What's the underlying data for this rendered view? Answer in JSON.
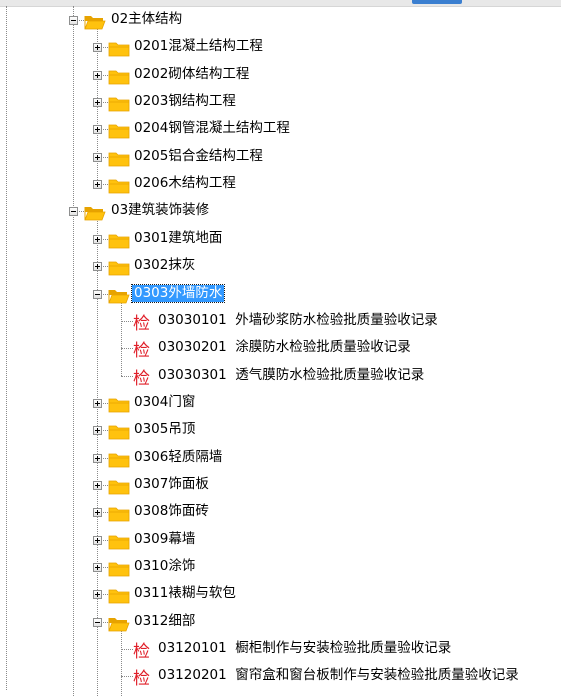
{
  "colors": {
    "folder_fill": "#ffc20e",
    "folder_dark": "#e7a300",
    "selected_bg": "#3399ff",
    "check_icon": "#e0202a"
  },
  "tree": {
    "nodes": [
      {
        "id": "n02",
        "label": "02主体结构",
        "level": 1,
        "kind": "folder",
        "state": "open"
      },
      {
        "id": "n0201",
        "label": "0201混凝土结构工程",
        "level": 2,
        "kind": "folder",
        "state": "closed"
      },
      {
        "id": "n0202",
        "label": "0202砌体结构工程",
        "level": 2,
        "kind": "folder",
        "state": "closed"
      },
      {
        "id": "n0203",
        "label": "0203钢结构工程",
        "level": 2,
        "kind": "folder",
        "state": "closed"
      },
      {
        "id": "n0204",
        "label": "0204钢管混凝土结构工程",
        "level": 2,
        "kind": "folder",
        "state": "closed"
      },
      {
        "id": "n0205",
        "label": "0205铝合金结构工程",
        "level": 2,
        "kind": "folder",
        "state": "closed"
      },
      {
        "id": "n0206",
        "label": "0206木结构工程",
        "level": 2,
        "kind": "folder",
        "state": "closed"
      },
      {
        "id": "n03",
        "label": "03建筑装饰装修",
        "level": 1,
        "kind": "folder",
        "state": "open"
      },
      {
        "id": "n0301",
        "label": "0301建筑地面",
        "level": 2,
        "kind": "folder",
        "state": "closed"
      },
      {
        "id": "n0302",
        "label": "0302抹灰",
        "level": 2,
        "kind": "folder",
        "state": "closed"
      },
      {
        "id": "n0303",
        "label": "0303外墙防水",
        "level": 2,
        "kind": "folder",
        "state": "open",
        "selected": true
      },
      {
        "id": "n03030101",
        "label": "03030101  外墙砂浆防水检验批质量验收记录",
        "level": 3,
        "kind": "record"
      },
      {
        "id": "n03030201",
        "label": "03030201  涂膜防水检验批质量验收记录",
        "level": 3,
        "kind": "record"
      },
      {
        "id": "n03030301",
        "label": "03030301  透气膜防水检验批质量验收记录",
        "level": 3,
        "kind": "record"
      },
      {
        "id": "n0304",
        "label": "0304门窗",
        "level": 2,
        "kind": "folder",
        "state": "closed"
      },
      {
        "id": "n0305",
        "label": "0305吊顶",
        "level": 2,
        "kind": "folder",
        "state": "closed"
      },
      {
        "id": "n0306",
        "label": "0306轻质隔墙",
        "level": 2,
        "kind": "folder",
        "state": "closed"
      },
      {
        "id": "n0307",
        "label": "0307饰面板",
        "level": 2,
        "kind": "folder",
        "state": "closed"
      },
      {
        "id": "n0308",
        "label": "0308饰面砖",
        "level": 2,
        "kind": "folder",
        "state": "closed"
      },
      {
        "id": "n0309",
        "label": "0309幕墙",
        "level": 2,
        "kind": "folder",
        "state": "closed"
      },
      {
        "id": "n0310",
        "label": "0310涂饰",
        "level": 2,
        "kind": "folder",
        "state": "closed"
      },
      {
        "id": "n0311",
        "label": "0311裱糊与软包",
        "level": 2,
        "kind": "folder",
        "state": "closed"
      },
      {
        "id": "n0312",
        "label": "0312细部",
        "level": 2,
        "kind": "folder",
        "state": "open"
      },
      {
        "id": "n03120101",
        "label": "03120101  橱柜制作与安装检验批质量验收记录",
        "level": 3,
        "kind": "record"
      },
      {
        "id": "n03120201",
        "label": "03120201  窗帘盒和窗台板制作与安装检验批质量验收记录",
        "level": 3,
        "kind": "record"
      }
    ],
    "record_icon_text": "检"
  }
}
